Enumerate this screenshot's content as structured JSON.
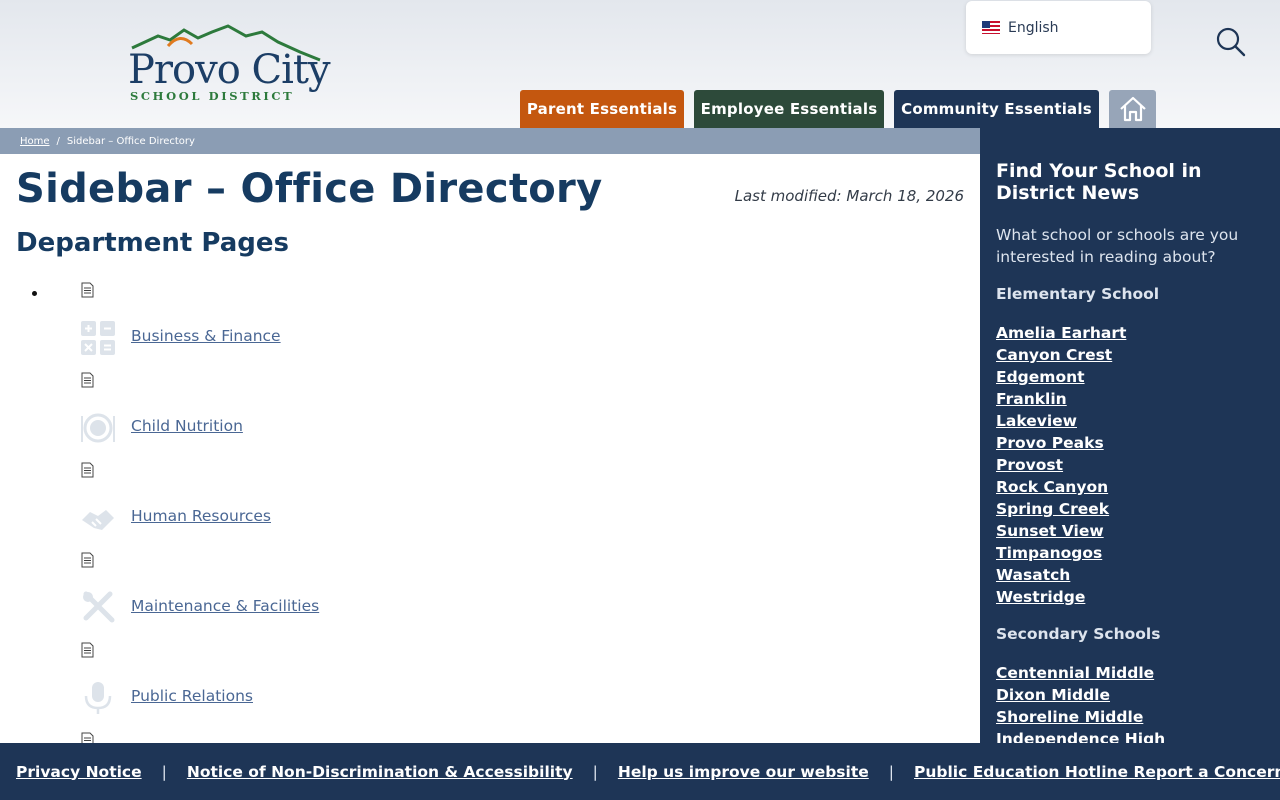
{
  "header": {
    "logo": {
      "main": "Provo City",
      "sub": "SCHOOL DISTRICT"
    },
    "language": {
      "label": "English",
      "flag_icon": "us-flag-icon"
    },
    "search_icon": "search-icon",
    "tabs": [
      {
        "label": "Parent Essentials",
        "color": "#c4570f"
      },
      {
        "label": "Employee Essentials",
        "color": "#2d4a3a"
      },
      {
        "label": "Community Essentials",
        "color": "#1e3556"
      },
      {
        "label": "",
        "icon": "home-icon",
        "color": "#97a5b8"
      }
    ]
  },
  "breadcrumb": {
    "home": "Home",
    "separator": "/",
    "current": "Sidebar – Office Directory"
  },
  "main": {
    "title": "Sidebar – Office Directory",
    "last_modified": "Last modified: March 18, 2026",
    "section_title": "Department Pages",
    "departments": [
      {
        "label": "Business & Finance",
        "icon": "calculator-icon"
      },
      {
        "label": "Child Nutrition",
        "icon": "plate-icon"
      },
      {
        "label": "Human Resources",
        "icon": "handshake-icon"
      },
      {
        "label": "Maintenance & Facilities",
        "icon": "tools-icon"
      },
      {
        "label": "Public Relations",
        "icon": "microphone-icon"
      }
    ]
  },
  "sidebar": {
    "title": "Find Your School in District News",
    "description": "What school or schools are you interested in reading about?",
    "groups": [
      {
        "heading": "Elementary School",
        "items": [
          "Amelia Earhart",
          "Canyon Crest",
          "Edgemont",
          "Franklin",
          "Lakeview",
          "Provo Peaks",
          "Provost",
          "Rock Canyon",
          "Spring Creek",
          "Sunset View",
          "Timpanogos",
          "Wasatch",
          "Westridge"
        ]
      },
      {
        "heading": "Secondary Schools",
        "items": [
          "Centennial Middle",
          "Dixon Middle",
          "Shoreline Middle",
          "Independence High"
        ]
      }
    ]
  },
  "footer": {
    "separator": "|",
    "links": [
      "Privacy Notice",
      "Notice of Non-Discrimination & Accessibility",
      "Help us improve our website",
      "Public Education Hotline Report a Concern Form"
    ]
  },
  "colors": {
    "navy": "#1e3556",
    "orange": "#c4570f",
    "green": "#2d4a3a",
    "link": "#4a6794",
    "breadcrumb_bg": "#8b9db4"
  }
}
